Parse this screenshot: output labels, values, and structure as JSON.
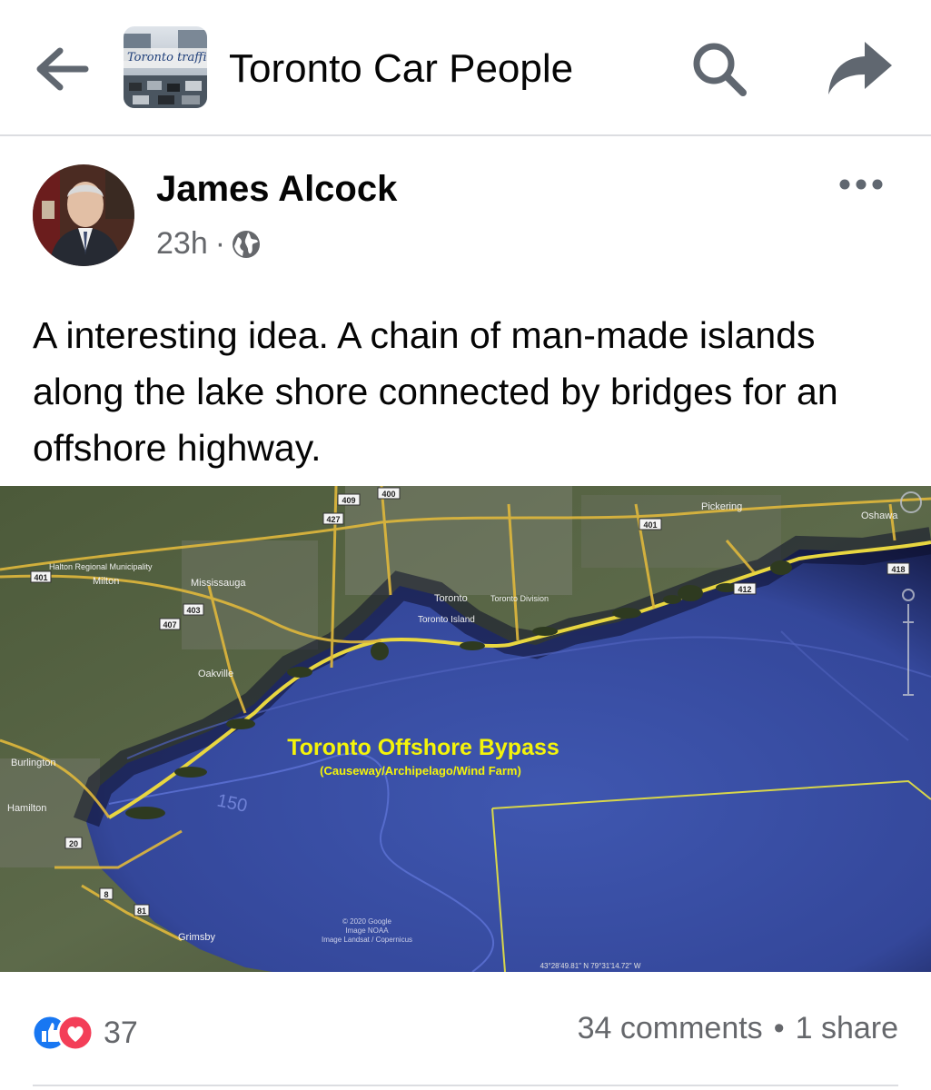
{
  "header": {
    "group_name": "Toronto Car People",
    "thumbnail_caption": "Toronto traffic m"
  },
  "post": {
    "author": "James Alcock",
    "time": "23h",
    "separator": "·",
    "text": "A interesting idea. A chain of man-made islands along the lake shore connected by bridges for an offshore highway."
  },
  "map": {
    "title": "Toronto Offshore Bypass",
    "subtitle": "(Causeway/Archipelago/Wind Farm)",
    "places": {
      "pickering": "Pickering",
      "oshawa": "Oshawa",
      "halton": "Halton Regional Municipality",
      "milton": "Milton",
      "mississauga": "Mississauga",
      "toronto": "Toronto",
      "toronto_division": "Toronto Division",
      "toronto_island": "Toronto Island",
      "oakville": "Oakville",
      "burlington": "Burlington",
      "hamilton": "Hamilton",
      "grimsby": "Grimsby"
    },
    "highways": {
      "h409": "409",
      "h400": "400",
      "h427": "427",
      "h401_east": "401",
      "h401_west": "401",
      "h418": "418",
      "h412": "412",
      "h403": "403",
      "h407": "407",
      "h20": "20",
      "h8": "8",
      "h81": "81"
    },
    "depth_label": "150",
    "attribution_1": "© 2020 Google",
    "attribution_2": "Image NOAA",
    "attribution_3": "Image Landsat / Copernicus",
    "coordinates": "43°28'49.81\" N   79°31'14.72\" W"
  },
  "footer": {
    "reaction_count": "37",
    "comments": "34 comments",
    "bullet": "•",
    "shares": "1 share"
  },
  "colors": {
    "text_primary": "#050505",
    "text_secondary": "#65676b",
    "like_blue": "#1877f2",
    "love_red": "#f33e58",
    "lake_blue": "#3a4fa8",
    "map_label_yellow": "#f4f40a"
  }
}
